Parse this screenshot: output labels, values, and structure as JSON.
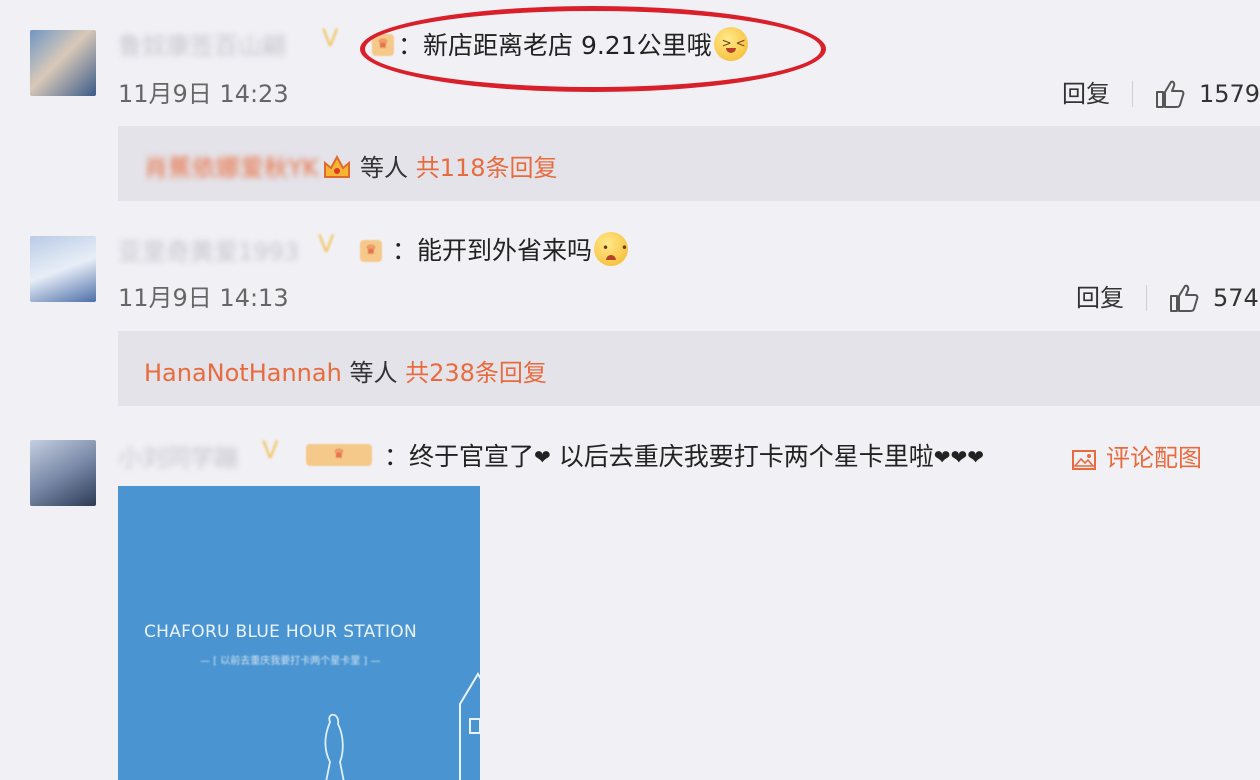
{
  "comments": [
    {
      "username": "鲁奴康签百山翩",
      "text": "：新店距离老店 9.21公里哦",
      "time": "11月9日 14:23",
      "reply_label": "回复",
      "likes": "1579",
      "replies": {
        "first_replier": "肖蕉依娜爱秋YK",
        "etc": "等人",
        "count_text": "共118条回复"
      }
    },
    {
      "username": "亚里奇黄爱1993",
      "text": "：能开到外省来吗",
      "time": "11月9日 14:13",
      "reply_label": "回复",
      "likes": "574",
      "replies": {
        "first_replier": "HanaNotHannah",
        "etc": "等人",
        "count_text": "共238条回复"
      }
    },
    {
      "username": "小刘同学蹦",
      "text": "：终于官宣了",
      "text_after": "以后去重庆我要打卡两个星卡里啦",
      "pic_link": "评论配图",
      "attachment": {
        "title": "CHAFORU BLUE HOUR STATION",
        "subtitle": "— [ 以前去重庆我要打卡两个星卡里 ] —"
      }
    }
  ],
  "colors": {
    "background": "#f1f0f5",
    "accent": "#e86b3d",
    "annotation": "#d9202a",
    "attachment_bg": "#4a95d1"
  },
  "icons": [
    "thumb-up-icon",
    "image-icon",
    "crown-icon",
    "vip-badge-icon",
    "emoji-icon",
    "heart-icon"
  ]
}
